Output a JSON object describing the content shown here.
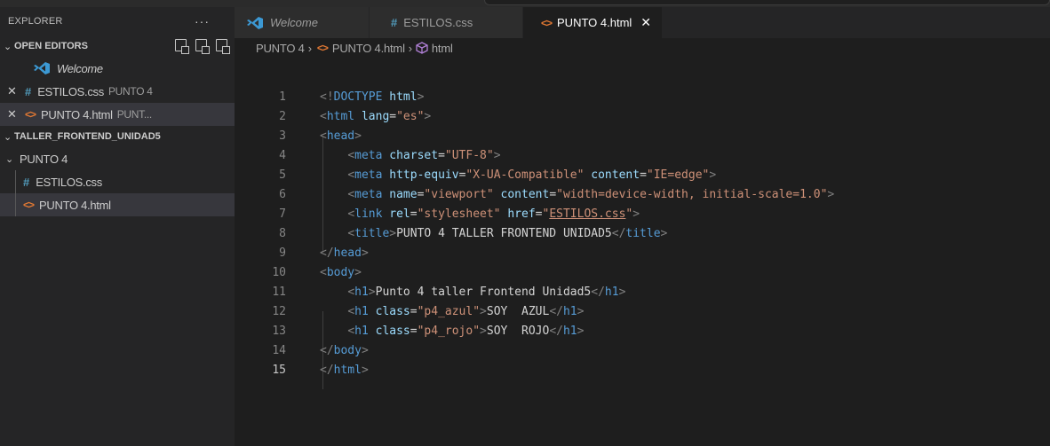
{
  "sidebar": {
    "title": "EXPLORER",
    "more": "···",
    "open_editors": {
      "label": "OPEN EDITORS",
      "items": [
        {
          "name": "Welcome",
          "hint": ""
        },
        {
          "name": "ESTILOS.css",
          "hint": "PUNTO 4"
        },
        {
          "name": "PUNTO 4.html",
          "hint": "PUNT..."
        }
      ]
    },
    "workspace": {
      "label": "TALLER_FRONTEND_UNIDAD5",
      "folder": "PUNTO 4",
      "files": [
        {
          "name": "ESTILOS.css"
        },
        {
          "name": "PUNTO 4.html"
        }
      ]
    }
  },
  "tabs": [
    {
      "label": "Welcome"
    },
    {
      "label": "ESTILOS.css"
    },
    {
      "label": "PUNTO 4.html",
      "close": "✕"
    }
  ],
  "breadcrumb": {
    "folder": "PUNTO 4",
    "file": "PUNTO 4.html",
    "symbol": "html",
    "sep": "›"
  },
  "editor": {
    "line_numbers": [
      "1",
      "2",
      "3",
      "4",
      "5",
      "6",
      "7",
      "8",
      "9",
      "10",
      "11",
      "12",
      "13",
      "14",
      "15"
    ],
    "current_line": 15,
    "lines": [
      [
        [
          "br",
          "<!"
        ],
        [
          "doc",
          "DOCTYPE "
        ],
        [
          "attr",
          "html"
        ],
        [
          "br",
          ">"
        ]
      ],
      [
        [
          "br",
          "<"
        ],
        [
          "tag",
          "html"
        ],
        [
          "txt",
          " "
        ],
        [
          "attr",
          "lang"
        ],
        [
          "txt",
          "="
        ],
        [
          "str",
          "\"es\""
        ],
        [
          "br",
          ">"
        ]
      ],
      [
        [
          "br",
          "<"
        ],
        [
          "tag",
          "head"
        ],
        [
          "br",
          ">"
        ]
      ],
      [
        [
          "txt",
          "    "
        ],
        [
          "br",
          "<"
        ],
        [
          "tag",
          "meta"
        ],
        [
          "txt",
          " "
        ],
        [
          "attr",
          "charset"
        ],
        [
          "txt",
          "="
        ],
        [
          "str",
          "\"UTF-8\""
        ],
        [
          "br",
          ">"
        ]
      ],
      [
        [
          "txt",
          "    "
        ],
        [
          "br",
          "<"
        ],
        [
          "tag",
          "meta"
        ],
        [
          "txt",
          " "
        ],
        [
          "attr",
          "http-equiv"
        ],
        [
          "txt",
          "="
        ],
        [
          "str",
          "\"X-UA-Compatible\""
        ],
        [
          "txt",
          " "
        ],
        [
          "attr",
          "content"
        ],
        [
          "txt",
          "="
        ],
        [
          "str",
          "\"IE=edge\""
        ],
        [
          "br",
          ">"
        ]
      ],
      [
        [
          "txt",
          "    "
        ],
        [
          "br",
          "<"
        ],
        [
          "tag",
          "meta"
        ],
        [
          "txt",
          " "
        ],
        [
          "attr",
          "name"
        ],
        [
          "txt",
          "="
        ],
        [
          "str",
          "\"viewport\""
        ],
        [
          "txt",
          " "
        ],
        [
          "attr",
          "content"
        ],
        [
          "txt",
          "="
        ],
        [
          "str",
          "\"width=device-width, initial-scale=1.0\""
        ],
        [
          "br",
          ">"
        ]
      ],
      [
        [
          "txt",
          "    "
        ],
        [
          "br",
          "<"
        ],
        [
          "tag",
          "link"
        ],
        [
          "txt",
          " "
        ],
        [
          "attr",
          "rel"
        ],
        [
          "txt",
          "="
        ],
        [
          "str",
          "\"stylesheet\""
        ],
        [
          "txt",
          " "
        ],
        [
          "attr",
          "href"
        ],
        [
          "txt",
          "="
        ],
        [
          "str",
          "\""
        ],
        [
          "strlink",
          "ESTILOS.css"
        ],
        [
          "str",
          "\""
        ],
        [
          "br",
          ">"
        ]
      ],
      [
        [
          "txt",
          "    "
        ],
        [
          "br",
          "<"
        ],
        [
          "tag",
          "title"
        ],
        [
          "br",
          ">"
        ],
        [
          "txt",
          "PUNTO 4 TALLER FRONTEND UNIDAD5"
        ],
        [
          "br",
          "</"
        ],
        [
          "tag",
          "title"
        ],
        [
          "br",
          ">"
        ]
      ],
      [
        [
          "br",
          "</"
        ],
        [
          "tag",
          "head"
        ],
        [
          "br",
          ">"
        ]
      ],
      [
        [
          "br",
          "<"
        ],
        [
          "tag",
          "body"
        ],
        [
          "br",
          ">"
        ]
      ],
      [
        [
          "txt",
          "    "
        ],
        [
          "br",
          "<"
        ],
        [
          "tag",
          "h1"
        ],
        [
          "br",
          ">"
        ],
        [
          "txt",
          "Punto 4 taller Frontend Unidad5"
        ],
        [
          "br",
          "</"
        ],
        [
          "tag",
          "h1"
        ],
        [
          "br",
          ">"
        ]
      ],
      [
        [
          "txt",
          "    "
        ],
        [
          "br",
          "<"
        ],
        [
          "tag",
          "h1"
        ],
        [
          "txt",
          " "
        ],
        [
          "attr",
          "class"
        ],
        [
          "txt",
          "="
        ],
        [
          "str",
          "\"p4_azul\""
        ],
        [
          "br",
          ">"
        ],
        [
          "txt",
          "SOY  AZUL"
        ],
        [
          "br",
          "</"
        ],
        [
          "tag",
          "h1"
        ],
        [
          "br",
          ">"
        ]
      ],
      [
        [
          "txt",
          "    "
        ],
        [
          "br",
          "<"
        ],
        [
          "tag",
          "h1"
        ],
        [
          "txt",
          " "
        ],
        [
          "attr",
          "class"
        ],
        [
          "txt",
          "="
        ],
        [
          "str",
          "\"p4_rojo\""
        ],
        [
          "br",
          ">"
        ],
        [
          "txt",
          "SOY  ROJO"
        ],
        [
          "br",
          "</"
        ],
        [
          "tag",
          "h1"
        ],
        [
          "br",
          ">"
        ]
      ],
      [
        [
          "br",
          "</"
        ],
        [
          "tag",
          "body"
        ],
        [
          "br",
          ">"
        ]
      ],
      [
        [
          "br",
          "</"
        ],
        [
          "tag",
          "html"
        ],
        [
          "br",
          ">"
        ]
      ]
    ]
  },
  "colors": {
    "accent_vs": "#3c99d4",
    "css_icon": "#519aba",
    "html_icon": "#e37933"
  }
}
